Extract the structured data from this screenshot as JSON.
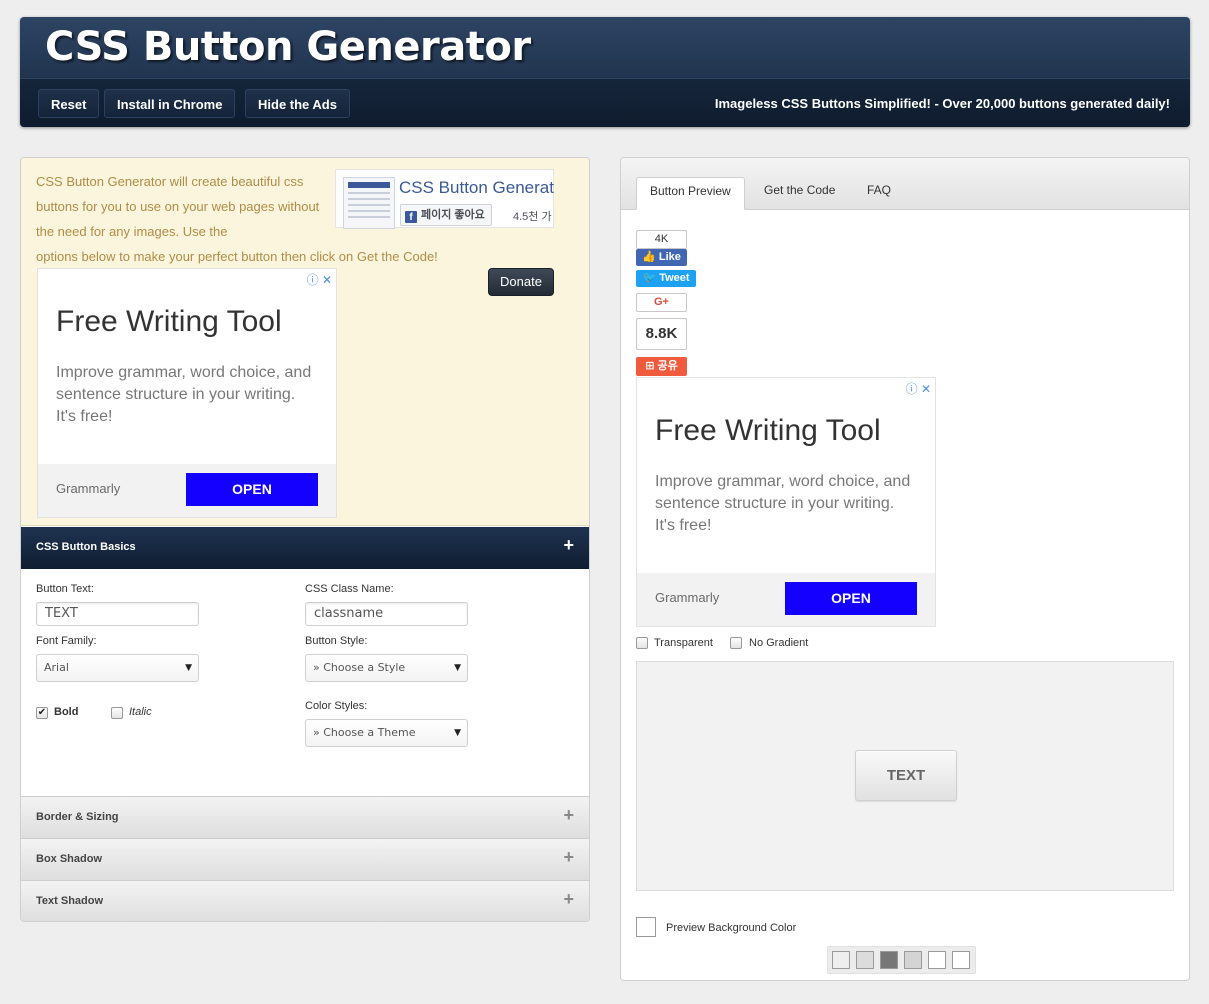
{
  "header": {
    "title": "CSS Button Generator",
    "nav": [
      "Reset",
      "Install in Chrome",
      "Hide the Ads"
    ],
    "tagline": "Imageless CSS Buttons Simplified! - Over 20,000 buttons generated daily!"
  },
  "intro": {
    "text": "CSS Button Generator will create beautiful css buttons for you to use on your web pages without the need for any images. Use the",
    "text_last": "options below to make your perfect button then click on Get the Code!",
    "fb": {
      "page_name": "CSS Button Generator",
      "like_label": "페이지 좋아요",
      "like_count": "4.5천 가"
    },
    "donate_label": "Donate"
  },
  "ad": {
    "close": "ⓘ ✕",
    "headline": "Free Writing Tool",
    "body": "Improve grammar, word choice, and sentence structure in your writing. It's free!",
    "brand": "Grammarly",
    "cta": "OPEN"
  },
  "basics": {
    "title": "CSS Button Basics",
    "plus": "+",
    "button_text_label": "Button Text:",
    "button_text_value": "TEXT",
    "class_name_label": "CSS Class Name:",
    "class_name_value": "classname",
    "font_family_label": "Font Family:",
    "font_family_value": "Arial",
    "button_style_label": "Button Style:",
    "button_style_value": "» Choose a Style",
    "color_styles_label": "Color Styles:",
    "color_styles_value": "» Choose a Theme",
    "bold_label": "Bold",
    "bold_checked": "✔",
    "italic_label": "Italic",
    "select_arrow": "▼"
  },
  "sections": [
    "Border & Sizing",
    "Box Shadow",
    "Text Shadow"
  ],
  "tabs": [
    "Button Preview",
    "Get the Code",
    "FAQ"
  ],
  "social": {
    "fb_count": "4K",
    "fb_label": "Like",
    "tweet_label": "Tweet",
    "gplus_label": "G+",
    "share_count": "8.8K",
    "share_label": "공유"
  },
  "preview": {
    "transparent_label": "Transparent",
    "no_gradient_label": "No Gradient",
    "button_text": "TEXT",
    "bg_color_label": "Preview Background Color",
    "swatches": [
      "#eeeeee",
      "#dcdcdc",
      "#777777",
      "#d4d4d4",
      "#ffffff",
      "#ffffff"
    ]
  }
}
